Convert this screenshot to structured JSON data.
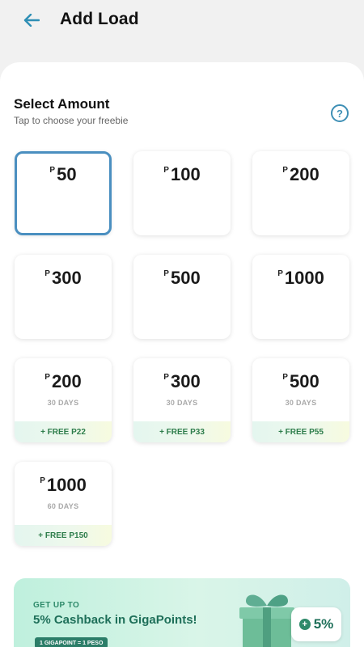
{
  "header": {
    "title": "Add Load"
  },
  "section": {
    "title": "Select Amount",
    "subtitle": "Tap to choose your freebie",
    "help_icon": "?"
  },
  "currency_symbol": "P",
  "plain_amounts": [
    {
      "amount": "50",
      "selected": true
    },
    {
      "amount": "100",
      "selected": false
    },
    {
      "amount": "200",
      "selected": false
    },
    {
      "amount": "300",
      "selected": false
    },
    {
      "amount": "500",
      "selected": false
    },
    {
      "amount": "1000",
      "selected": false
    }
  ],
  "promo_amounts": [
    {
      "amount": "200",
      "validity": "30 DAYS",
      "freebie": "+ FREE P22"
    },
    {
      "amount": "300",
      "validity": "30 DAYS",
      "freebie": "+ FREE P33"
    },
    {
      "amount": "500",
      "validity": "30 DAYS",
      "freebie": "+ FREE P55"
    },
    {
      "amount": "1000",
      "validity": "60 DAYS",
      "freebie": "+ FREE P150"
    }
  ],
  "promo_banner": {
    "eyebrow": "GET UP TO",
    "title": "5% Cashback in GigaPoints!",
    "pill": "1 GIGAPOINT = 1 PESO",
    "badge_text": "5%",
    "colors": {
      "accent": "#2e8a6a",
      "selected_border": "#4a8fc0"
    }
  }
}
